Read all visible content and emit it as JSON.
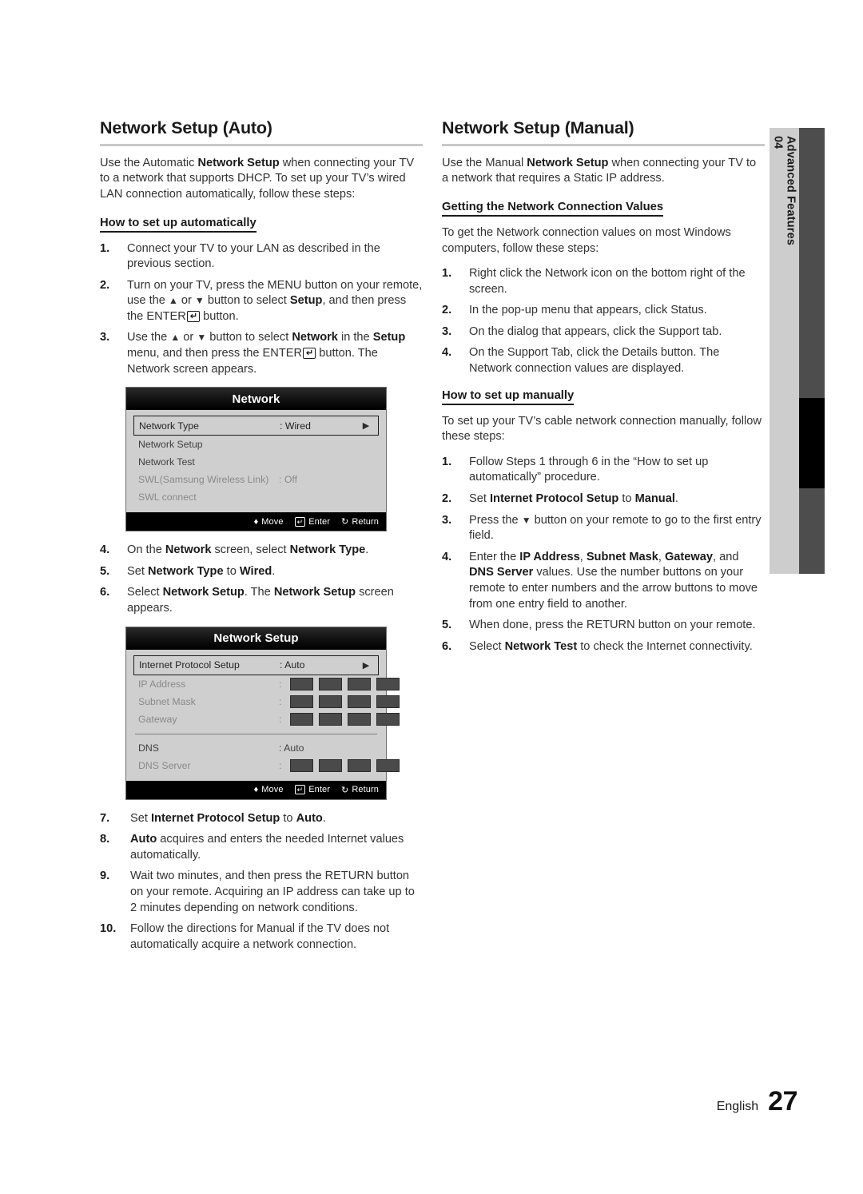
{
  "page": {
    "language_label": "English",
    "page_number": "27"
  },
  "side_tab": {
    "chapter_number": "04",
    "chapter_title": "Advanced Features"
  },
  "left_column": {
    "heading": "Network Setup (Auto)",
    "intro": "Use the Automatic Network Setup when connecting your TV to a network that supports DHCP. To set up your TV’s wired LAN connection automatically, follow these steps:",
    "subhead": "How to set up automatically",
    "steps_1_3": [
      {
        "num": "1.",
        "text": "Connect your TV to your LAN as described in the previous section."
      },
      {
        "num": "2.",
        "text": "Turn on your TV, press the MENU button on your remote, use the ▲ or ▼ button to select Setup, and then press the ENTER⏎ button."
      },
      {
        "num": "3.",
        "text": "Use the ▲ or ▼ button to select Network in the Setup menu, and then press the ENTER⏎ button. The Network screen appears."
      }
    ],
    "steps_4_6": [
      {
        "num": "4.",
        "text": "On the Network screen, select Network Type."
      },
      {
        "num": "5.",
        "text": "Set Network Type to Wired."
      },
      {
        "num": "6.",
        "text": "Select Network Setup. The Network Setup screen appears."
      }
    ],
    "steps_7_10": [
      {
        "num": "7.",
        "text": "Set Internet Protocol Setup to Auto."
      },
      {
        "num": "8.",
        "text": "Auto acquires and enters the needed Internet values automatically."
      },
      {
        "num": "9.",
        "text": "Wait two minutes, and then press the RETURN button on your remote. Acquiring an IP address can take  up to 2 minutes depending on network conditions."
      },
      {
        "num": "10.",
        "text": "Follow the directions for Manual if the TV does not automatically acquire a network connection."
      }
    ]
  },
  "right_column": {
    "heading": "Network Setup (Manual)",
    "intro": "Use the Manual Network Setup when connecting your TV to a network that requires a Static IP address.",
    "subhead_values": "Getting the Network Connection Values",
    "values_intro": "To get the Network connection values on most Windows computers, follow these steps:",
    "values_steps": [
      {
        "num": "1.",
        "text": "Right click the Network icon on the bottom right of the screen."
      },
      {
        "num": "2.",
        "text": "In the pop-up menu that appears, click Status."
      },
      {
        "num": "3.",
        "text": "On the dialog that appears, click the Support tab."
      },
      {
        "num": "4.",
        "text": "On the Support Tab, click the Details button. The Network connection values are displayed."
      }
    ],
    "subhead_manual": "How to set up manually",
    "manual_intro": "To set up your TV’s cable network connection manually, follow these steps:",
    "manual_steps": [
      {
        "num": "1.",
        "text": "Follow Steps 1 through 6 in the “How to set up automatically” procedure."
      },
      {
        "num": "2.",
        "text": "Set Internet Protocol Setup to Manual."
      },
      {
        "num": "3.",
        "text": "Press the ▼ button on your remote to go to the first entry field."
      },
      {
        "num": "4.",
        "text": "Enter the IP Address, Subnet Mask, Gateway, and DNS Server values. Use the number buttons on your remote to enter numbers and the arrow buttons to move from one entry field to another."
      },
      {
        "num": "5.",
        "text": "When done, press the RETURN button on your remote."
      },
      {
        "num": "6.",
        "text": "Select Network Test to check the Internet connectivity."
      }
    ]
  },
  "osd_network": {
    "title": "Network",
    "rows": [
      {
        "label": "Network Type",
        "value": ": Wired",
        "chevron": "▶",
        "selected": true,
        "dimmed": false
      },
      {
        "label": "Network Setup",
        "value": "",
        "chevron": "",
        "selected": false,
        "dimmed": false
      },
      {
        "label": "Network Test",
        "value": "",
        "chevron": "",
        "selected": false,
        "dimmed": false
      },
      {
        "label": "SWL(Samsung Wireless Link)",
        "value": ": Off",
        "chevron": "",
        "selected": false,
        "dimmed": true
      },
      {
        "label": "SWL connect",
        "value": "",
        "chevron": "",
        "selected": false,
        "dimmed": true
      }
    ],
    "footer": {
      "move": "Move",
      "enter": "Enter",
      "return": "Return"
    }
  },
  "osd_network_setup": {
    "title": "Network Setup",
    "rows_top": [
      {
        "label": "Internet Protocol Setup",
        "value": ": Auto",
        "chevron": "▶",
        "selected": true,
        "dimmed": false,
        "cells": 0
      },
      {
        "label": "IP Address",
        "value": ":",
        "chevron": "",
        "selected": false,
        "dimmed": true,
        "cells": 4
      },
      {
        "label": "Subnet Mask",
        "value": ":",
        "chevron": "",
        "selected": false,
        "dimmed": true,
        "cells": 4
      },
      {
        "label": "Gateway",
        "value": ":",
        "chevron": "",
        "selected": false,
        "dimmed": true,
        "cells": 4
      }
    ],
    "rows_bottom": [
      {
        "label": "DNS",
        "value": ": Auto",
        "chevron": "",
        "selected": false,
        "dimmed": false,
        "cells": 0
      },
      {
        "label": "DNS Server",
        "value": ":",
        "chevron": "",
        "selected": false,
        "dimmed": true,
        "cells": 4
      }
    ],
    "footer": {
      "move": "Move",
      "enter": "Enter",
      "return": "Return"
    }
  }
}
